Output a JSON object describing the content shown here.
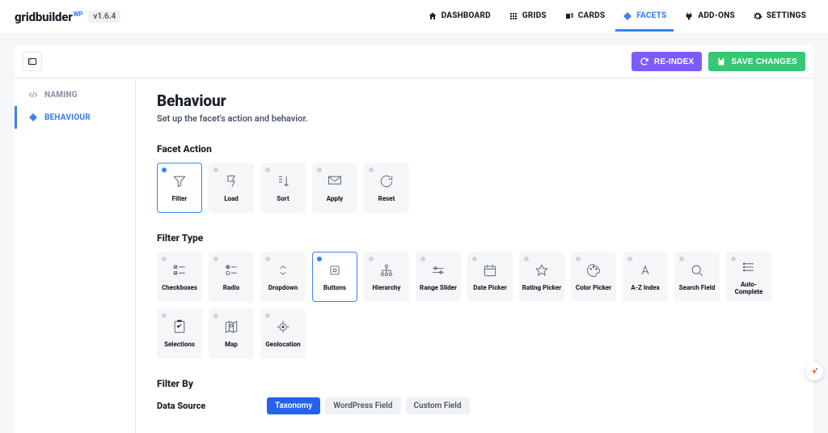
{
  "app": {
    "name": "gridbuilder",
    "badge": "WP",
    "version": "v1.6.4"
  },
  "nav": {
    "dashboard": "DASHBOARD",
    "grids": "GRIDS",
    "cards": "CARDS",
    "facets": "FACETS",
    "addons": "ADD-ONS",
    "settings": "SETTINGS"
  },
  "toolbar": {
    "reindex": "RE-INDEX",
    "save": "SAVE CHANGES"
  },
  "sidebar": {
    "naming": "NAMING",
    "behaviour": "BEHAVIOUR"
  },
  "page": {
    "title": "Behaviour",
    "subtitle": "Set up the facet's action and behavior."
  },
  "facet_action": {
    "label": "Facet Action",
    "items": [
      {
        "id": "filter",
        "label": "Filter",
        "selected": true
      },
      {
        "id": "load",
        "label": "Load",
        "selected": false
      },
      {
        "id": "sort",
        "label": "Sort",
        "selected": false
      },
      {
        "id": "apply",
        "label": "Apply",
        "selected": false
      },
      {
        "id": "reset",
        "label": "Reset",
        "selected": false
      }
    ]
  },
  "filter_type": {
    "label": "Filter Type",
    "items": [
      {
        "id": "checkboxes",
        "label": "Checkboxes",
        "selected": false
      },
      {
        "id": "radio",
        "label": "Radio",
        "selected": false
      },
      {
        "id": "dropdown",
        "label": "Dropdown",
        "selected": false
      },
      {
        "id": "buttons",
        "label": "Buttons",
        "selected": true
      },
      {
        "id": "hierarchy",
        "label": "Hierarchy",
        "selected": false
      },
      {
        "id": "range-slider",
        "label": "Range Slider",
        "selected": false
      },
      {
        "id": "date-picker",
        "label": "Date Picker",
        "selected": false
      },
      {
        "id": "rating-picker",
        "label": "Rating Picker",
        "selected": false
      },
      {
        "id": "color-picker",
        "label": "Color Picker",
        "selected": false
      },
      {
        "id": "az-index",
        "label": "A-Z Index",
        "selected": false
      },
      {
        "id": "search-field",
        "label": "Search Field",
        "selected": false
      },
      {
        "id": "auto-complete",
        "label": "Auto-Complete",
        "selected": false
      },
      {
        "id": "selections",
        "label": "Selections",
        "selected": false
      },
      {
        "id": "map",
        "label": "Map",
        "selected": false
      },
      {
        "id": "geolocation",
        "label": "Geolocation",
        "selected": false
      }
    ]
  },
  "filter_by": {
    "label": "Filter By",
    "data_source_label": "Data Source",
    "options": [
      {
        "id": "taxonomy",
        "label": "Taxonomy",
        "active": true
      },
      {
        "id": "wp-field",
        "label": "WordPress Field",
        "active": false
      },
      {
        "id": "custom-field",
        "label": "Custom Field",
        "active": false
      }
    ]
  }
}
